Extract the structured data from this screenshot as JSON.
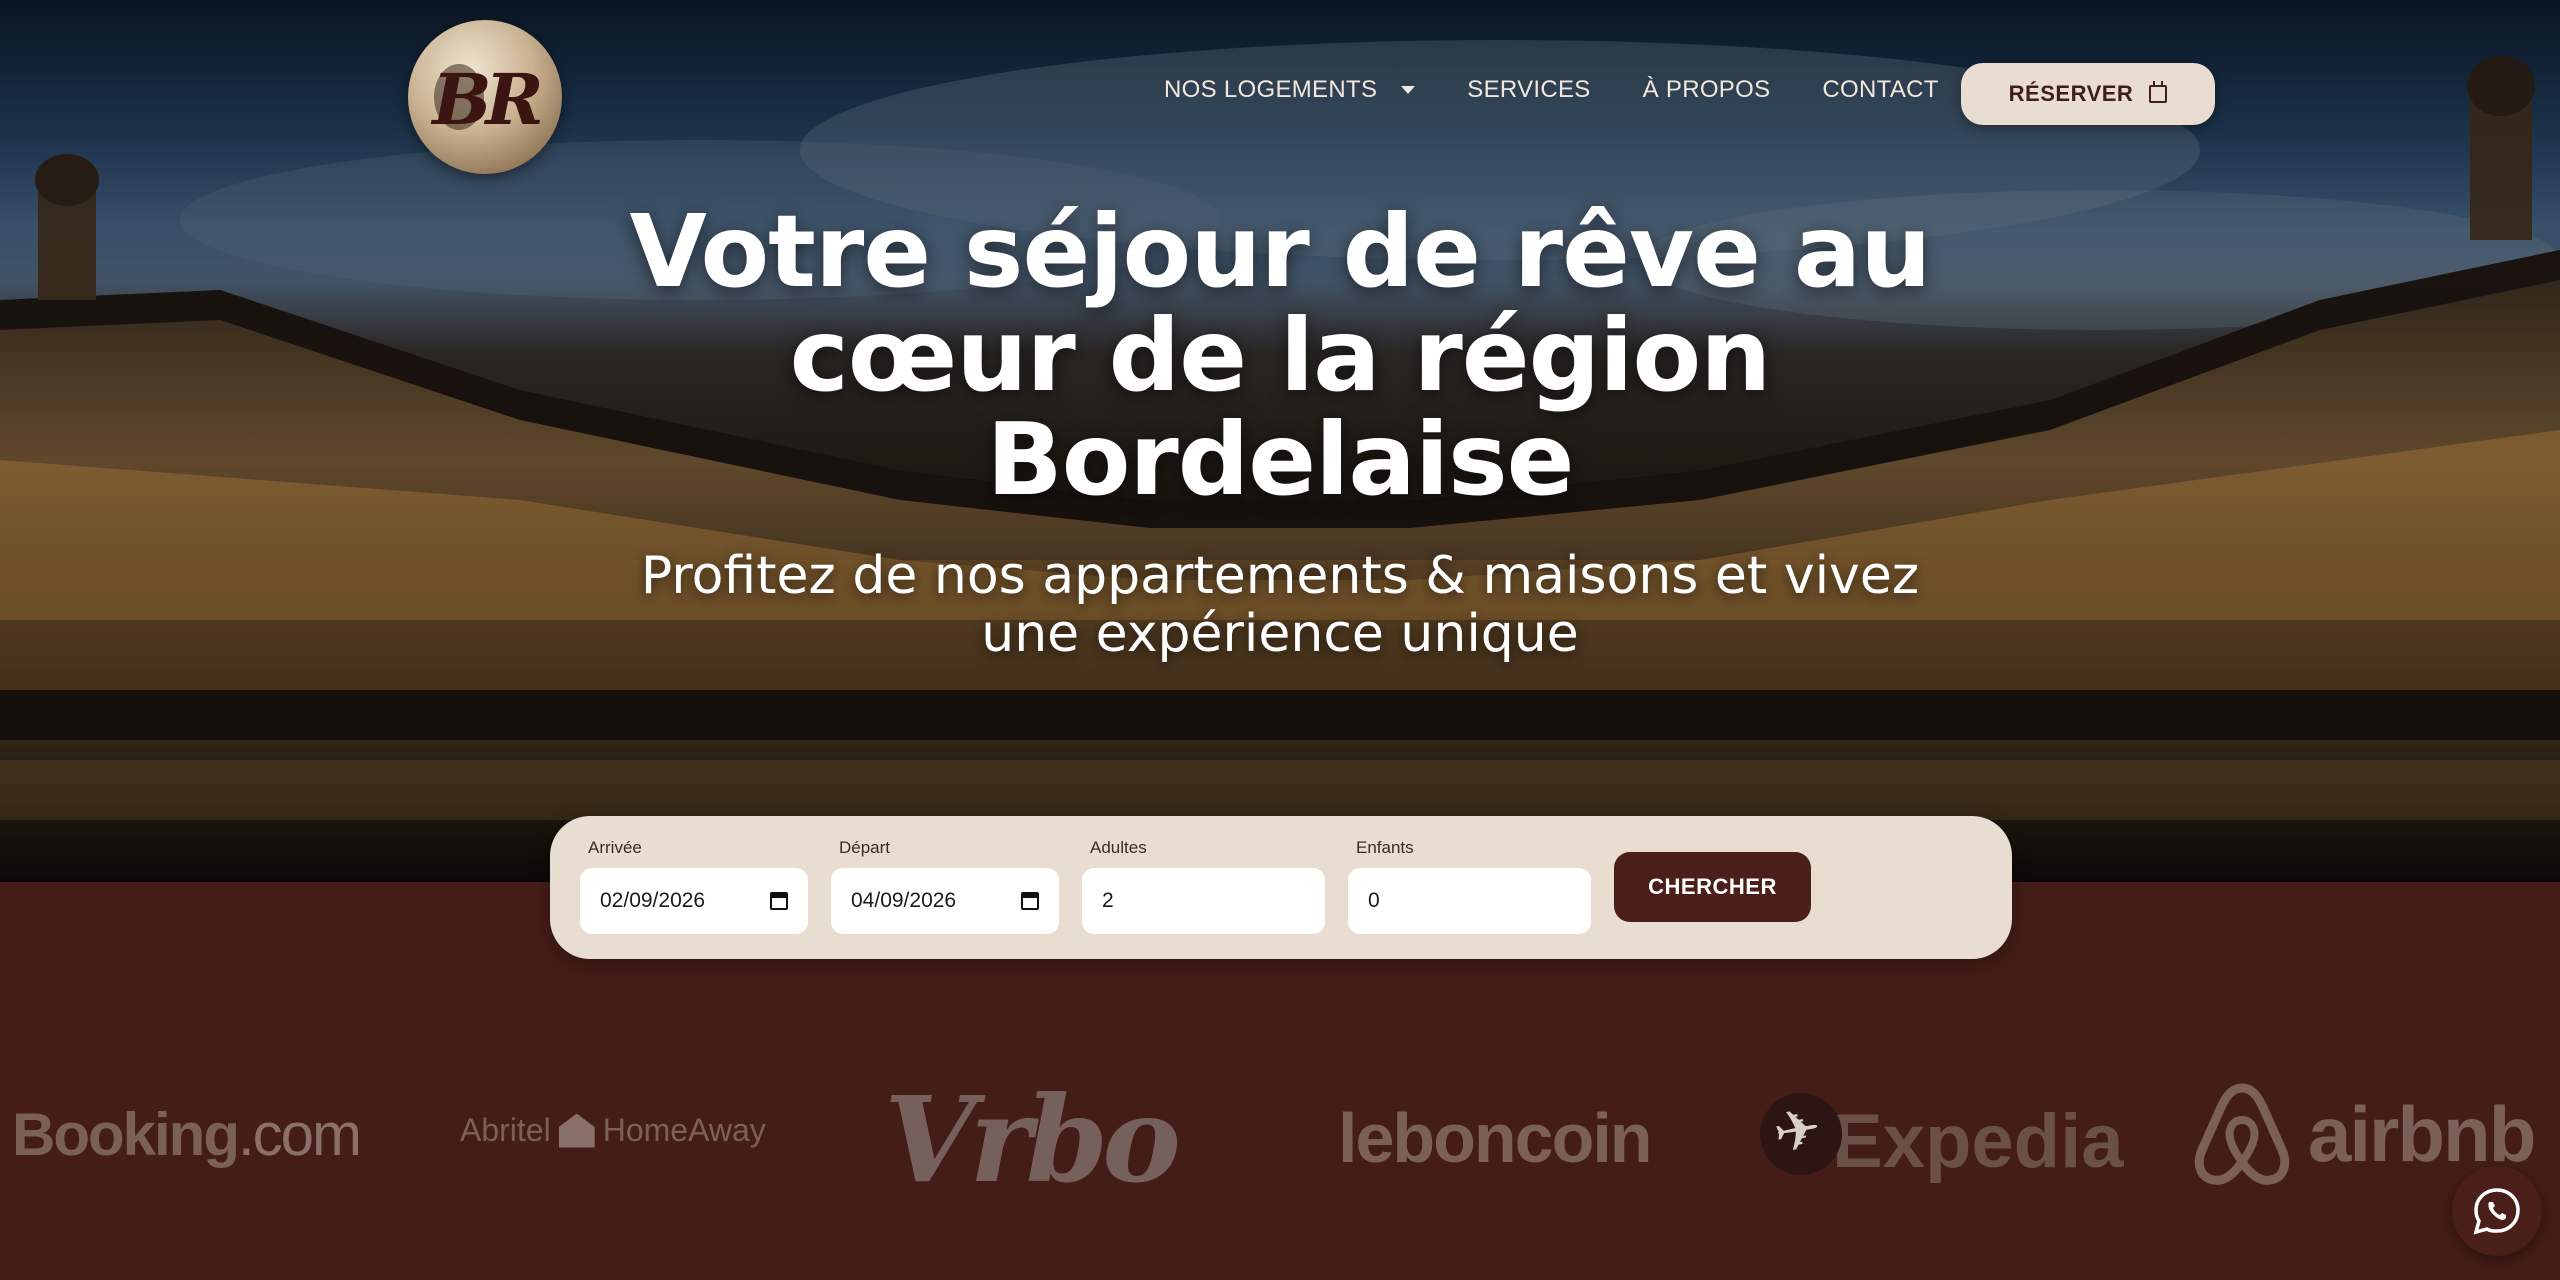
{
  "brand": {
    "logo_text": "BR"
  },
  "nav": {
    "items": [
      {
        "label": "NOS LOGEMENTS",
        "has_dropdown": true
      },
      {
        "label": "SERVICES"
      },
      {
        "label": "À PROPOS"
      },
      {
        "label": "CONTACT"
      }
    ],
    "cta_label": "RÉSERVER"
  },
  "hero": {
    "title_lines": [
      "Votre séjour de rêve au",
      "cœur de la région",
      "Bordelaise"
    ],
    "subtitle_lines": [
      "Profitez de nos appartements & maisons et vivez",
      "une expérience unique"
    ]
  },
  "search": {
    "arrival": {
      "label": "Arrivée",
      "value": "02/09/2026"
    },
    "departure": {
      "label": "Départ",
      "value": "04/09/2026"
    },
    "adults": {
      "label": "Adultes",
      "value": "2"
    },
    "children": {
      "label": "Enfants",
      "value": "0"
    },
    "submit_label": "CHERCHER"
  },
  "partners": {
    "booking": {
      "name": "Booking",
      "suffix": ".com"
    },
    "abritel": {
      "left": "Abritel",
      "right": "HomeAway"
    },
    "vrbo": "Vrbo",
    "leboncoin": "leboncoin",
    "expedia": "Expedia",
    "airbnb": "airbnb"
  },
  "colors": {
    "background": "#451d18",
    "panel": "#e8ddd0",
    "accent": "#4a1e19",
    "partner_logo": "#7b605a"
  },
  "icons": [
    "calendar-icon",
    "chevron-down-icon",
    "whatsapp-icon",
    "airplane-icon",
    "airbnb-icon",
    "house-icon"
  ]
}
